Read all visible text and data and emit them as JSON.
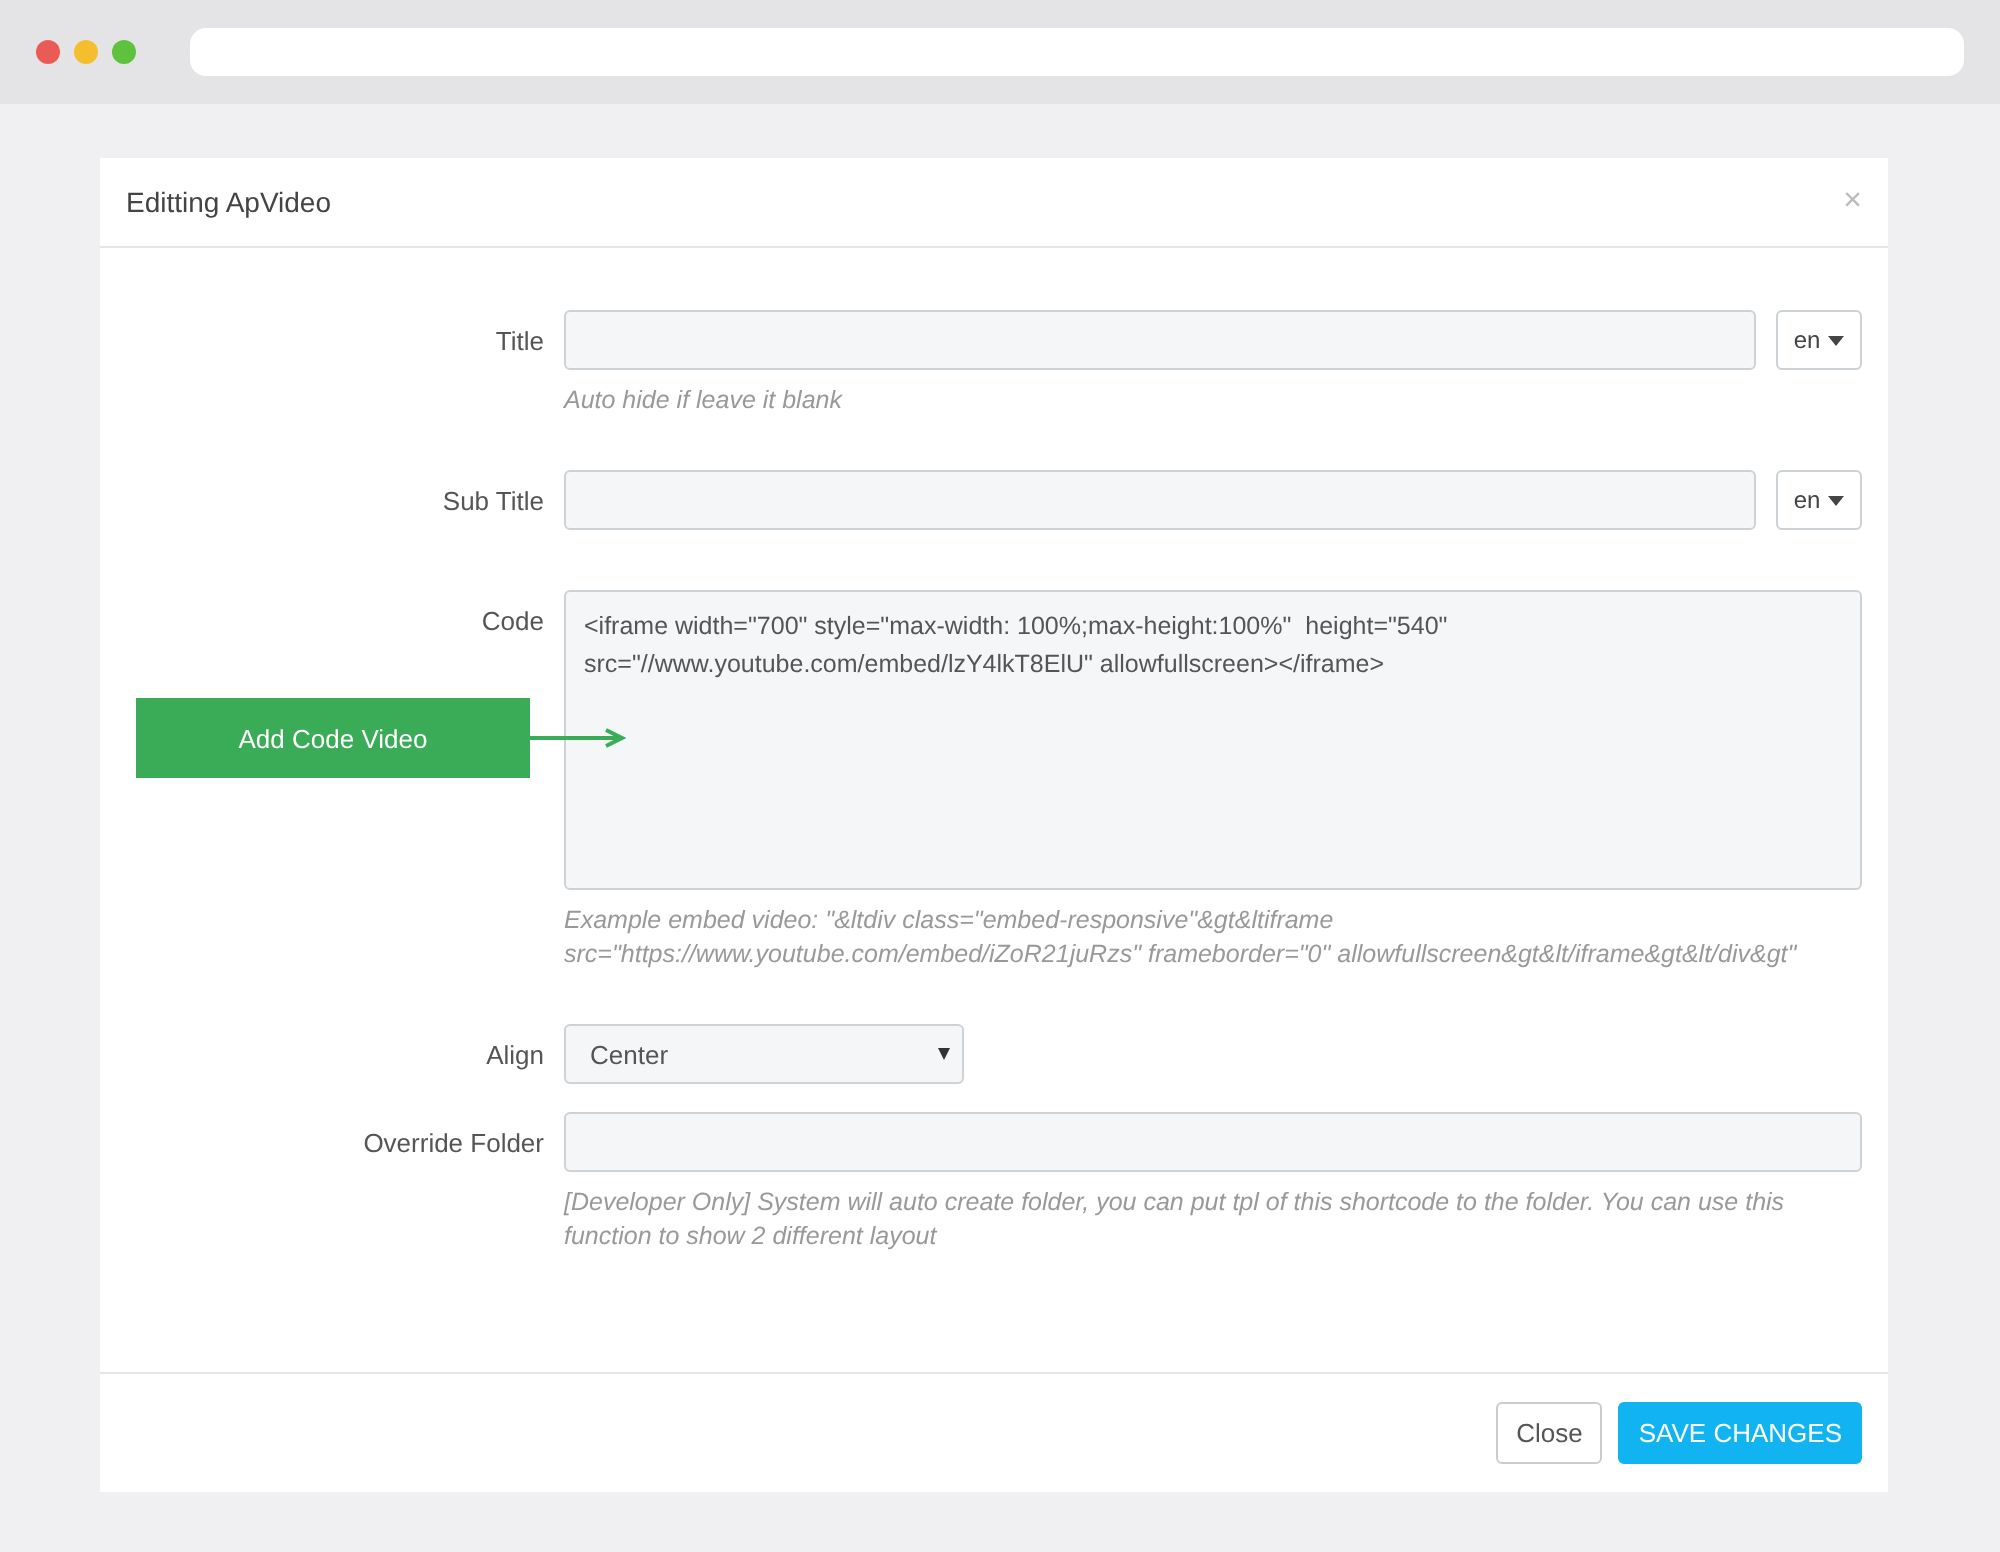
{
  "modal": {
    "title": "Editting ApVideo",
    "close_icon": "×"
  },
  "fields": [
    {
      "kind": "text",
      "label": "Title",
      "language": "en",
      "help": "Auto hide if leave it blank"
    },
    {
      "kind": "text",
      "label": "Sub Title",
      "language": "en"
    },
    {
      "kind": "code",
      "label": "Code",
      "value": "<iframe width=\"700\" style=\"max-width: 100%;max-height:100%\"  height=\"540\" src=\"//www.youtube.com/embed/lzY4lkT8ElU\" allowfullscreen></iframe>",
      "help": "Example embed video: \"&ltdiv class=\"embed-responsive\"&gt&ltiframe src=\"https://www.youtube.com/embed/iZoR21juRzs\" frameborder=\"0\" allowfullscreen&gt&lt/iframe&gt&lt/div&gt\""
    },
    {
      "kind": "select",
      "label": "Align",
      "value": "Center"
    },
    {
      "kind": "text",
      "label": "Override Folder",
      "help": "[Developer Only] System will auto create folder, you can put tpl of this shortcode to the folder. You can use this function to show 2 different layout"
    }
  ],
  "annotation": {
    "label": "Add Code Video"
  },
  "buttons": [
    {
      "label": "Close",
      "kind": "default"
    },
    {
      "label": "SAVE CHANGES",
      "kind": "primary"
    }
  ]
}
